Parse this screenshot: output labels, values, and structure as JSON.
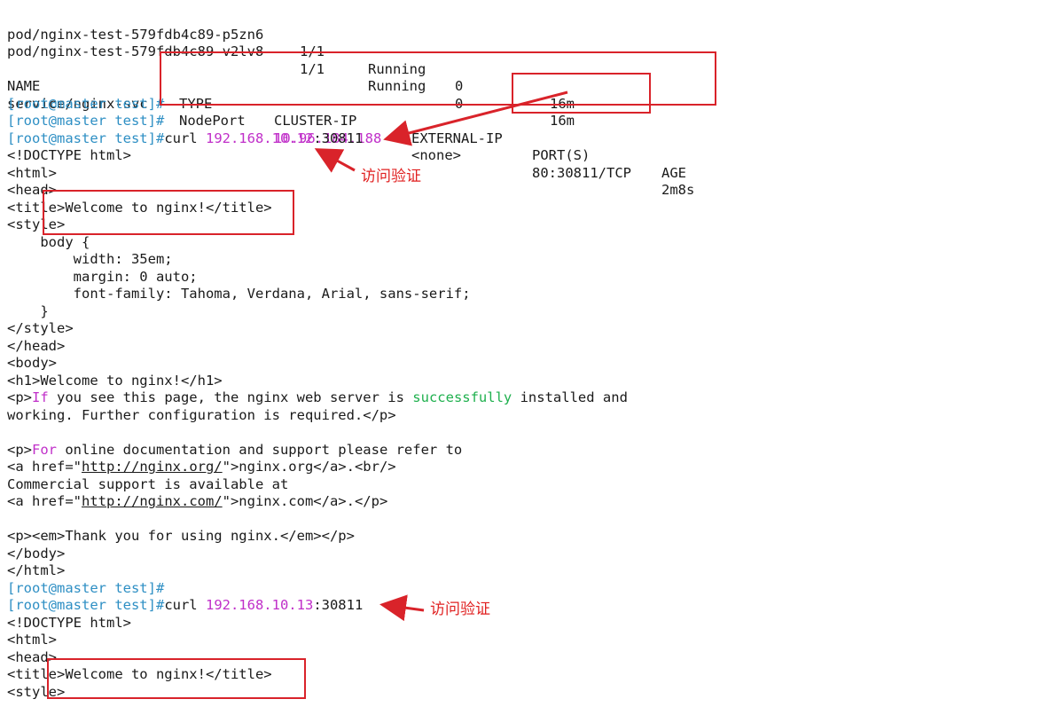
{
  "pods": [
    {
      "name": "pod/nginx-test-579fdb4c89-p5zn6",
      "ready": "1/1",
      "status": "Running",
      "restarts": "0",
      "age": "16m"
    },
    {
      "name": "pod/nginx-test-579fdb4c89-v2lv8",
      "ready": "1/1",
      "status": "Running",
      "restarts": "0",
      "age": "16m"
    }
  ],
  "svc": {
    "headers": {
      "name": "NAME",
      "type": "TYPE",
      "cluster_ip": "CLUSTER-IP",
      "external_ip": "EXTERNAL-IP",
      "ports": "PORT(S)",
      "age": "AGE"
    },
    "row": {
      "name": "service/nginx-svc",
      "type": "NodePort",
      "cluster_ip": "10.96.184.188",
      "external_ip": "<none>",
      "ports": "80:30811/TCP",
      "age": "2m8s"
    }
  },
  "prompt": "[root@master test]#",
  "curl1": {
    "cmd": "curl ",
    "ip": "192.168.10.12",
    "port": ":30811"
  },
  "curl2": {
    "cmd": "curl ",
    "ip": "192.168.10.13",
    "port": ":30811"
  },
  "html_lines": {
    "doctype": "<!DOCTYPE html>",
    "html_open": "<html>",
    "head_open": "<head>",
    "title": "<title>Welcome to nginx!</title>",
    "style_open": "<style>",
    "body_sel": "    body {",
    "width": "        width: 35em;",
    "margin": "        margin: 0 auto;",
    "font": "        font-family: Tahoma, Verdana, Arial, sans-serif;",
    "brace": "    }",
    "style_close": "</style>",
    "head_close": "</head>",
    "body_open": "<body>",
    "h1": "<h1>Welcome to nginx!</h1>",
    "p1_a": "<p>",
    "p1_b": "If",
    "p1_c": " you see this page, the nginx web server is ",
    "p1_d": "successfully",
    "p1_e": " installed and",
    "p1_line2": "working. Further configuration is required.</p>",
    "p2_a": "<p>",
    "p2_b": "For",
    "p2_c": " online documentation and support please refer to",
    "a1_pre": "<a href=\"",
    "a1_url": "http://nginx.org/",
    "a1_post": "\">nginx.org</a>.<br/>",
    "commercial": "Commercial support is available at",
    "a2_pre": "<a href=\"",
    "a2_url": "http://nginx.com/",
    "a2_post": "\">nginx.com</a>.</p>",
    "thanks": "<p><em>Thank you for using nginx.</em></p>",
    "body_close": "</body>",
    "html_close": "</html>"
  },
  "annotations": {
    "note1": "访问验证",
    "note2": "访问验证"
  },
  "colors": {
    "prompt": "#2e8fc4",
    "ip": "#c02fc9",
    "green": "#1fb04e",
    "annotation": "#d9232a"
  }
}
